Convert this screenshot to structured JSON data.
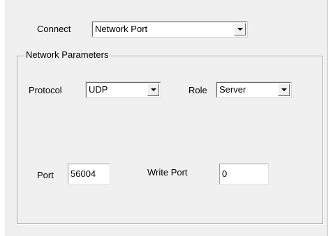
{
  "connect": {
    "label": "Connect",
    "selected": "Network Port"
  },
  "network_parameters": {
    "title": "Network Parameters",
    "protocol": {
      "label": "Protocol",
      "selected": "UDP"
    },
    "role": {
      "label": "Role",
      "selected": "Server"
    },
    "port": {
      "label": "Port",
      "value": "56004"
    },
    "write_port": {
      "label": "Write Port",
      "value": "0"
    }
  },
  "icons": {
    "dropdown": "chevron-down-icon"
  }
}
